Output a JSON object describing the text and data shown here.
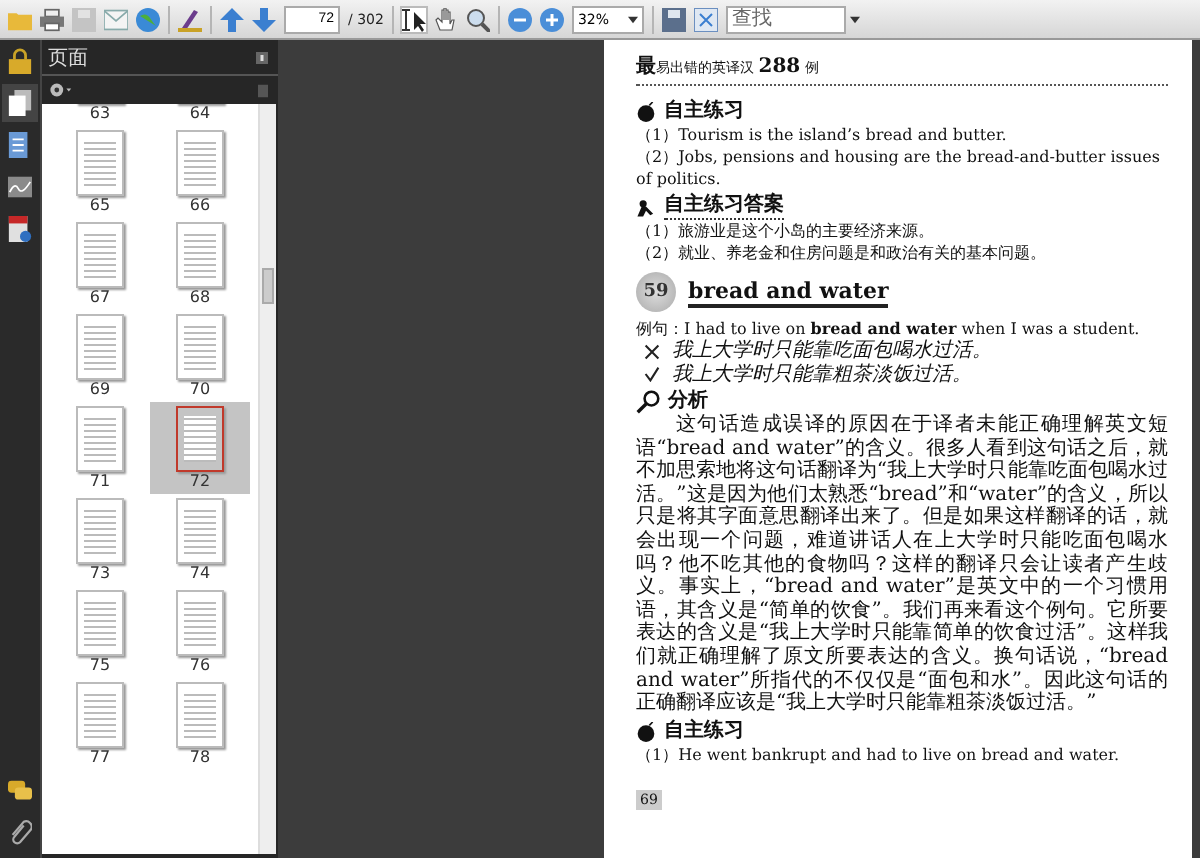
{
  "toolbar": {
    "page_number": "72",
    "page_total": "/ 302",
    "zoom": "32%",
    "search": {
      "placeholder": "查找"
    }
  },
  "sidebar": {
    "title": "页面",
    "thumbnails": [
      {
        "label": "63",
        "selected": false
      },
      {
        "label": "64",
        "selected": false
      },
      {
        "label": "65",
        "selected": false
      },
      {
        "label": "66",
        "selected": false
      },
      {
        "label": "67",
        "selected": false
      },
      {
        "label": "68",
        "selected": false
      },
      {
        "label": "69",
        "selected": false
      },
      {
        "label": "70",
        "selected": false
      },
      {
        "label": "71",
        "selected": false
      },
      {
        "label": "72",
        "selected": true
      },
      {
        "label": "73",
        "selected": false
      },
      {
        "label": "74",
        "selected": false
      },
      {
        "label": "75",
        "selected": false
      },
      {
        "label": "76",
        "selected": false
      },
      {
        "label": "77",
        "selected": false
      },
      {
        "label": "78",
        "selected": false
      }
    ]
  },
  "page": {
    "running_header": "**最**易出错的英译汉 **288** 例",
    "blocks": [
      {
        "kind": "exercise_title",
        "text": "自主练习"
      },
      {
        "kind": "line",
        "text": "（1）Tourism is the island’s bread and butter."
      },
      {
        "kind": "line",
        "text": "（2）Jobs, pensions and housing are the bread-and-butter issues of politics."
      },
      {
        "kind": "answer_title",
        "text": "自主练习答案"
      },
      {
        "kind": "line",
        "text": "（1）旅游业是这个小岛的主要经济来源。"
      },
      {
        "kind": "line",
        "text": "（2）就业、养老金和住房问题是和政治有关的基本问题。"
      },
      {
        "kind": "heading",
        "number": "59",
        "text": "bread and water"
      },
      {
        "kind": "line",
        "text": "例句：I had to live on **bread and water** when I was a student."
      },
      {
        "kind": "wrong",
        "text": "我上大学时只能靠吃面包喝水过活。"
      },
      {
        "kind": "right",
        "text": "我上大学时只能靠粗茶淡饭过活。"
      },
      {
        "kind": "analysis_title",
        "text": "分析"
      },
      {
        "kind": "paragraph",
        "text": "这句话造成误译的原因在于译者未能正确理解英文短语“bread and water”的含义。很多人看到这句话之后，就不加思索地将这句话翻译为“我上大学时只能靠吃面包喝水过活。”这是因为他们太熟悉“bread”和“water”的含义，所以只是将其字面意思翻译出来了。但是如果这样翻译的话，就会出现一个问题，难道讲话人在上大学时只能吃面包喝水吗？他不吃其他的食物吗？这样的翻译只会让读者产生歧义。事实上，“bread and water”是英文中的一个习惯用语，其含义是“简单的饮食”。我们再来看这个例句。它所要表达的含义是“我上大学时只能靠简单的饮食过活”。这样我们就正确理解了原文所要表达的含义。换句话说，“bread and water”所指代的不仅仅是“面包和水”。因此这句话的正确翻译应该是“我上大学时只能靠粗茶淡饭过活。”"
      },
      {
        "kind": "exercise_title",
        "text": "自主练习"
      },
      {
        "kind": "line",
        "text": "（1）He went bankrupt and had to live on bread and water."
      },
      {
        "kind": "page_number",
        "text": "69"
      }
    ]
  }
}
